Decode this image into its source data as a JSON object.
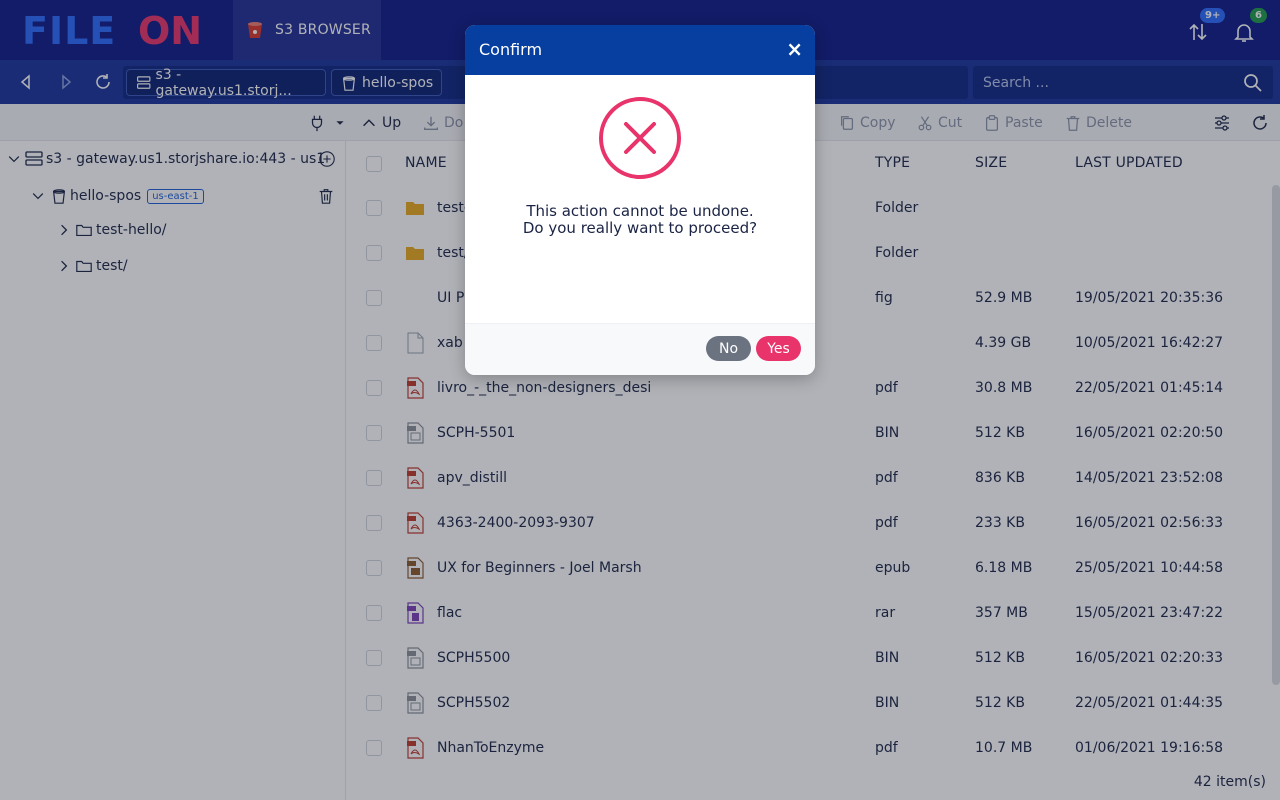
{
  "app": {
    "logo_text": "FILEON",
    "active_tab": "S3 BROWSER",
    "transfers_badge": "9+",
    "notifications_badge": "6"
  },
  "nav": {
    "crumbs": [
      "s3 - gateway.us1.storj...",
      "hello-spos"
    ],
    "search_placeholder": "Search ..."
  },
  "toolbar": {
    "up": "Up",
    "download": "Do",
    "copy": "Copy",
    "cut": "Cut",
    "paste": "Paste",
    "delete": "Delete"
  },
  "sidebar": {
    "connection": "s3 - gateway.us1.storjshare.io:443 - us1",
    "bucket": "hello-spos",
    "region": "us-east-1",
    "folders": [
      "test-hello/",
      "test/"
    ]
  },
  "filelist": {
    "columns": {
      "name": "NAME",
      "type": "TYPE",
      "size": "SIZE",
      "updated": "LAST UPDATED"
    },
    "rows": [
      {
        "name": "test-",
        "type": "Folder",
        "size": "",
        "updated": "",
        "icon": "folder-icon"
      },
      {
        "name": "test/",
        "type": "Folder",
        "size": "",
        "updated": "",
        "icon": "folder-icon"
      },
      {
        "name": "UI P",
        "type": "fig",
        "size": "52.9 MB",
        "updated": "19/05/2021 20:35:36",
        "icon": "none"
      },
      {
        "name": "xab",
        "type": "",
        "size": "4.39 GB",
        "updated": "10/05/2021 16:42:27",
        "icon": "file-icon"
      },
      {
        "name": "livro_-_the_non-designers_desi",
        "type": "pdf",
        "size": "30.8 MB",
        "updated": "22/05/2021 01:45:14",
        "icon": "pdf-icon"
      },
      {
        "name": "SCPH-5501",
        "type": "BIN",
        "size": "512 KB",
        "updated": "16/05/2021 02:20:50",
        "icon": "bin-icon"
      },
      {
        "name": "apv_distill",
        "type": "pdf",
        "size": "836 KB",
        "updated": "14/05/2021 23:52:08",
        "icon": "pdf-icon"
      },
      {
        "name": "4363-2400-2093-9307",
        "type": "pdf",
        "size": "233 KB",
        "updated": "16/05/2021 02:56:33",
        "icon": "pdf-icon"
      },
      {
        "name": "UX for Beginners - Joel Marsh",
        "type": "epub",
        "size": "6.18 MB",
        "updated": "25/05/2021 10:44:58",
        "icon": "epub-icon"
      },
      {
        "name": "flac",
        "type": "rar",
        "size": "357 MB",
        "updated": "15/05/2021 23:47:22",
        "icon": "rar-icon"
      },
      {
        "name": "SCPH5500",
        "type": "BIN",
        "size": "512 KB",
        "updated": "16/05/2021 02:20:33",
        "icon": "bin-icon"
      },
      {
        "name": "SCPH5502",
        "type": "BIN",
        "size": "512 KB",
        "updated": "22/05/2021 01:44:35",
        "icon": "bin-icon"
      },
      {
        "name": "NhanToEnzyme",
        "type": "pdf",
        "size": "10.7 MB",
        "updated": "01/06/2021 19:16:58",
        "icon": "pdf-icon"
      }
    ],
    "item_count": "42 item(s)"
  },
  "modal": {
    "title": "Confirm",
    "close": "×",
    "message_line1": "This action cannot be undone.",
    "message_line2": "Do you really want to proceed?",
    "no_label": "No",
    "yes_label": "Yes"
  },
  "colors": {
    "brand_blue": "#0d1a86",
    "accent_pink": "#e8336b",
    "modal_header": "#063fa0"
  }
}
